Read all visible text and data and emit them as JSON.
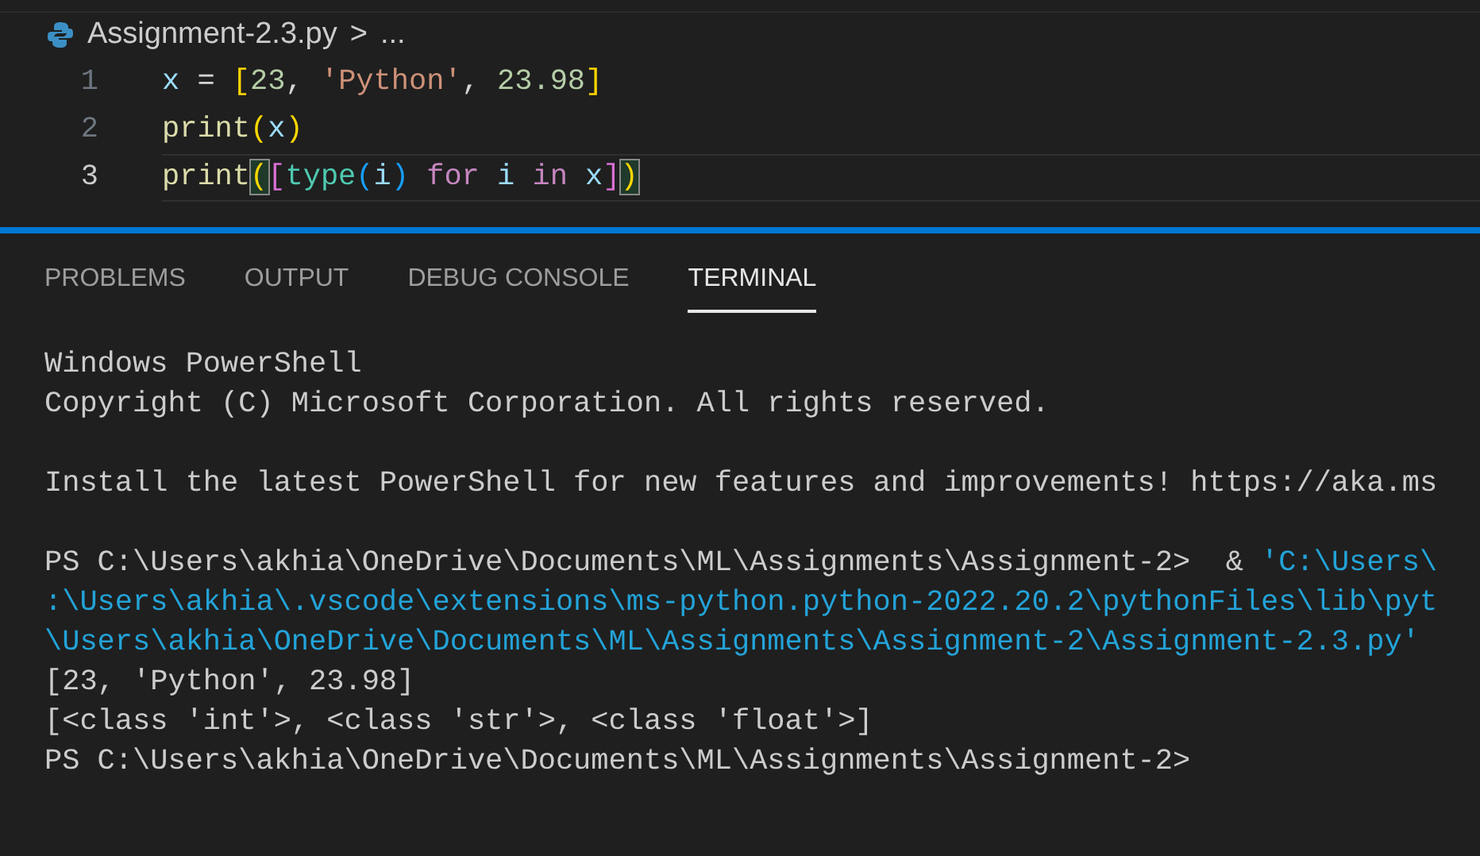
{
  "breadcrumb": {
    "file": "Assignment-2.3.py",
    "separator": ">",
    "more": "..."
  },
  "code_lines": [
    {
      "number": "1",
      "current": false,
      "tokens": [
        {
          "kind": "var",
          "text": "x"
        },
        {
          "kind": "op",
          "text": " = "
        },
        {
          "kind": "bracket1",
          "text": "["
        },
        {
          "kind": "num",
          "text": "23"
        },
        {
          "kind": "op",
          "text": ", "
        },
        {
          "kind": "str",
          "text": "'Python'"
        },
        {
          "kind": "op",
          "text": ", "
        },
        {
          "kind": "num",
          "text": "23.98"
        },
        {
          "kind": "bracket1",
          "text": "]"
        }
      ]
    },
    {
      "number": "2",
      "current": false,
      "tokens": [
        {
          "kind": "func",
          "text": "print"
        },
        {
          "kind": "bracket1",
          "text": "("
        },
        {
          "kind": "var",
          "text": "x"
        },
        {
          "kind": "bracket1",
          "text": ")"
        }
      ]
    },
    {
      "number": "3",
      "current": true,
      "tokens": [
        {
          "kind": "func",
          "text": "print"
        },
        {
          "kind": "bracket1",
          "text": "(",
          "match": true
        },
        {
          "kind": "bracket2",
          "text": "["
        },
        {
          "kind": "type",
          "text": "type"
        },
        {
          "kind": "bracket3",
          "text": "("
        },
        {
          "kind": "var",
          "text": "i"
        },
        {
          "kind": "bracket3",
          "text": ")"
        },
        {
          "kind": "keyword",
          "text": " for"
        },
        {
          "kind": "var",
          "text": " i"
        },
        {
          "kind": "keyword",
          "text": " in"
        },
        {
          "kind": "var",
          "text": " x"
        },
        {
          "kind": "bracket2",
          "text": "]"
        },
        {
          "kind": "bracket1",
          "text": ")",
          "match": true
        }
      ]
    }
  ],
  "panel_tabs": [
    {
      "label": "PROBLEMS",
      "selected": false
    },
    {
      "label": "OUTPUT",
      "selected": false
    },
    {
      "label": "DEBUG CONSOLE",
      "selected": false
    },
    {
      "label": "TERMINAL",
      "selected": true
    }
  ],
  "terminal_lines": [
    [
      {
        "kind": "plain",
        "text": "Windows PowerShell"
      }
    ],
    [
      {
        "kind": "plain",
        "text": "Copyright (C) Microsoft Corporation. All rights reserved."
      }
    ],
    [
      {
        "kind": "blank"
      }
    ],
    [
      {
        "kind": "plain",
        "text": "Install the latest PowerShell for new features and improvements! https://aka.ms"
      }
    ],
    [
      {
        "kind": "blank"
      }
    ],
    [
      {
        "kind": "plain",
        "text": "PS C:\\Users\\akhia\\OneDrive\\Documents\\ML\\Assignments\\Assignment-2>  & "
      },
      {
        "kind": "path",
        "text": "'C:\\Users\\"
      }
    ],
    [
      {
        "kind": "path",
        "text": ":\\Users\\akhia\\.vscode\\extensions\\ms-python.python-2022.20.2\\pythonFiles\\lib\\pyt"
      }
    ],
    [
      {
        "kind": "path",
        "text": "\\Users\\akhia\\OneDrive\\Documents\\ML\\Assignments\\Assignment-2\\Assignment-2.3.py'"
      }
    ],
    [
      {
        "kind": "plain",
        "text": "[23, 'Python', 23.98]"
      }
    ],
    [
      {
        "kind": "plain",
        "text": "[<class 'int'>, <class 'str'>, <class 'float'>]"
      }
    ],
    [
      {
        "kind": "plain",
        "text": "PS C:\\Users\\akhia\\OneDrive\\Documents\\ML\\Assignments\\Assignment-2>"
      }
    ]
  ]
}
